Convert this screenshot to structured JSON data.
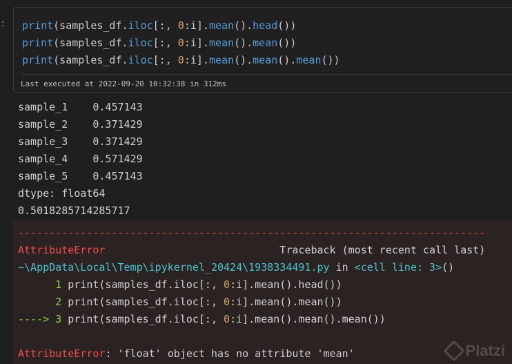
{
  "prompt_marker": ":",
  "code_cell": {
    "lines": [
      [
        {
          "t": "print",
          "c": "k-fn"
        },
        {
          "t": "(samples_df.",
          "c": ""
        },
        {
          "t": "iloc",
          "c": "k-fn"
        },
        {
          "t": "[:, ",
          "c": ""
        },
        {
          "t": "0",
          "c": "k-num"
        },
        {
          "t": ":i].",
          "c": ""
        },
        {
          "t": "mean",
          "c": "k-fn"
        },
        {
          "t": "().",
          "c": ""
        },
        {
          "t": "head",
          "c": "k-fn"
        },
        {
          "t": "())",
          "c": ""
        }
      ],
      [
        {
          "t": "print",
          "c": "k-fn"
        },
        {
          "t": "(samples_df.",
          "c": ""
        },
        {
          "t": "iloc",
          "c": "k-fn"
        },
        {
          "t": "[:, ",
          "c": ""
        },
        {
          "t": "0",
          "c": "k-num"
        },
        {
          "t": ":i].",
          "c": ""
        },
        {
          "t": "mean",
          "c": "k-fn"
        },
        {
          "t": "().",
          "c": ""
        },
        {
          "t": "mean",
          "c": "k-fn"
        },
        {
          "t": "())",
          "c": ""
        }
      ],
      [
        {
          "t": "print",
          "c": "k-fn"
        },
        {
          "t": "(samples_df.",
          "c": ""
        },
        {
          "t": "iloc",
          "c": "k-fn"
        },
        {
          "t": "[:, ",
          "c": ""
        },
        {
          "t": "0",
          "c": "k-num"
        },
        {
          "t": ":i].",
          "c": ""
        },
        {
          "t": "mean",
          "c": "k-fn"
        },
        {
          "t": "().",
          "c": ""
        },
        {
          "t": "mean",
          "c": "k-fn"
        },
        {
          "t": "().",
          "c": ""
        },
        {
          "t": "mean",
          "c": "k-fn"
        },
        {
          "t": "())",
          "c": ""
        }
      ]
    ],
    "status": "Last executed at 2022-09-20 10:32:38 in 312ms"
  },
  "output": {
    "lines": [
      "sample_1    0.457143",
      "sample_2    0.371429",
      "sample_3    0.371429",
      "sample_4    0.571429",
      "sample_5    0.457143",
      "dtype: float64",
      "0.5018285714285717"
    ]
  },
  "error": {
    "lines": [
      [
        {
          "t": "---------------------------------------------------------------------------",
          "c": "red"
        }
      ],
      [
        {
          "t": "AttributeError",
          "c": "red"
        },
        {
          "t": "                            Traceback (most recent call last)",
          "c": ""
        }
      ],
      [
        {
          "t": "~\\AppData\\Local\\Temp\\ipykernel_20424\\1938334491.py",
          "c": "cyan"
        },
        {
          "t": " in ",
          "c": ""
        },
        {
          "t": "<cell line: 3>",
          "c": "cyan"
        },
        {
          "t": "()",
          "c": ""
        }
      ],
      [
        {
          "t": "      1 ",
          "c": "green"
        },
        {
          "t": "print(samples_df.iloc[:, ",
          "c": ""
        },
        {
          "t": "0",
          "c": "k-num"
        },
        {
          "t": ":i].mean().head())",
          "c": ""
        }
      ],
      [
        {
          "t": "      2 ",
          "c": "green"
        },
        {
          "t": "print(samples_df.iloc[:, ",
          "c": ""
        },
        {
          "t": "0",
          "c": "k-num"
        },
        {
          "t": ":i].mean().mean())",
          "c": ""
        }
      ],
      [
        {
          "t": "----> 3 ",
          "c": "green"
        },
        {
          "t": "print(samples_df.iloc[:, ",
          "c": ""
        },
        {
          "t": "0",
          "c": "k-num"
        },
        {
          "t": ":i].mean().mean().mean())",
          "c": ""
        }
      ],
      [
        {
          "t": " ",
          "c": ""
        }
      ],
      [
        {
          "t": "AttributeError",
          "c": "red"
        },
        {
          "t": ": 'float' object has no attribute 'mean'",
          "c": ""
        }
      ]
    ]
  },
  "watermark": {
    "text": "Platzi",
    "icon": "platzi-logo-icon"
  },
  "colors": {
    "background": "#1f1f1f",
    "error_bg": "#2b2322",
    "keyword": "#569cd6",
    "number": "#d7a56a",
    "error": "#f14c4c",
    "path": "#4fc1cd",
    "lineno": "#8bd549"
  }
}
